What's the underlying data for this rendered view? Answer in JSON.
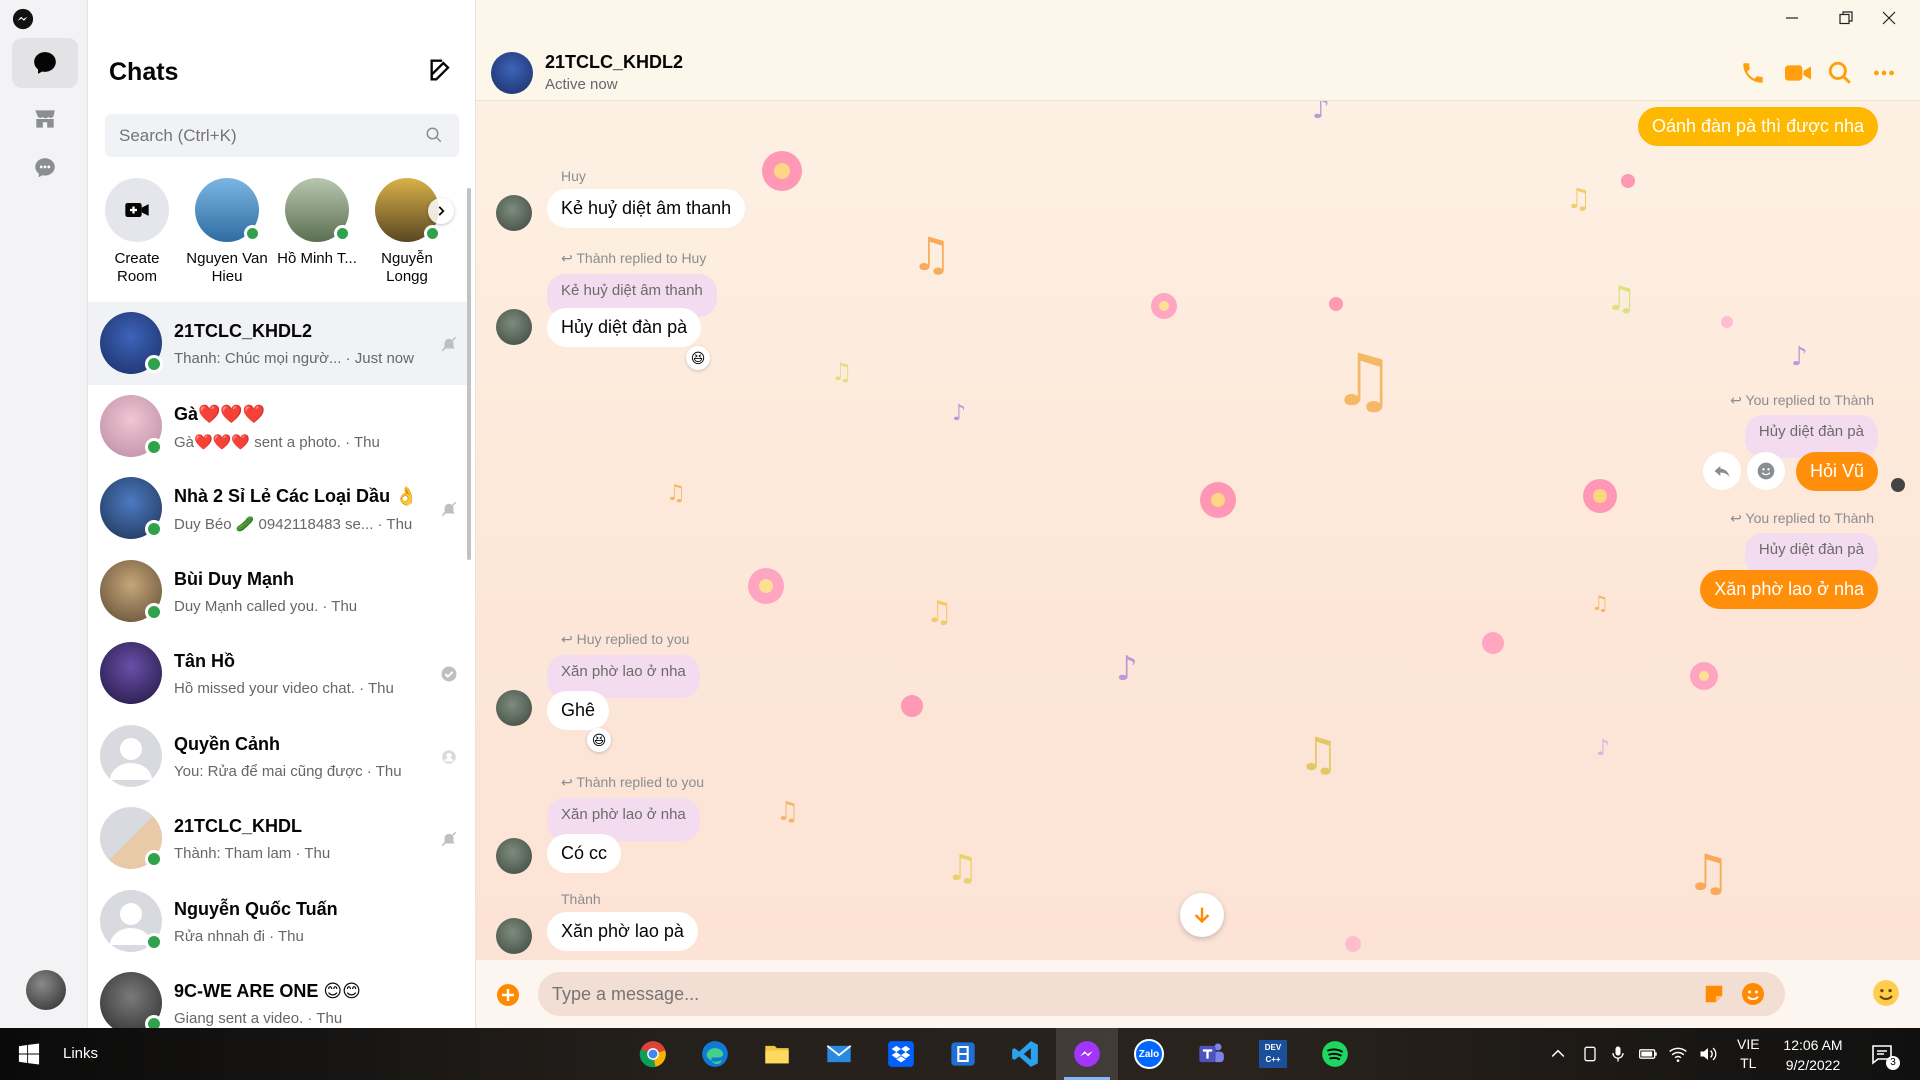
{
  "sidebar": {
    "title": "Chats",
    "search_placeholder": "Search (Ctrl+K)",
    "stories": [
      {
        "label": "Create Room"
      },
      {
        "label": "Nguyen Van Hieu",
        "online": true
      },
      {
        "label": "Hồ Minh T...",
        "online": true
      },
      {
        "label": "Nguyễn Longg",
        "online": true
      }
    ],
    "chats": [
      {
        "name": "21TCLC_KHDL2",
        "preview": "Thanh: Chúc mọi ngườ... · Just now",
        "online": true,
        "status_icon": "muted-bell-icon",
        "active": true
      },
      {
        "name": "Gà❤️❤️❤️",
        "preview": "Gà❤️❤️❤️ sent a photo. · Thu",
        "online": true,
        "status_icon": ""
      },
      {
        "name": "Nhà 2 Sỉ Lẻ Các Loại Dầu 👌",
        "preview": "Duy Béo 🥒 0942118483 se... · Thu",
        "online": true,
        "status_icon": "muted-bell-icon"
      },
      {
        "name": "Bùi Duy Mạnh",
        "preview": "Duy Mạnh called you. · Thu",
        "online": true,
        "status_icon": ""
      },
      {
        "name": "Tân Hồ",
        "preview": "Hồ missed your video chat. · Thu",
        "online": false,
        "status_icon": "delivered-check-icon"
      },
      {
        "name": "Quyền Cảnh",
        "preview": "You: Rửa để mai cũng được · Thu",
        "online": false,
        "status_icon": "seen-avatar-icon"
      },
      {
        "name": "21TCLC_KHDL",
        "preview": "Thành: Tham lam · Thu",
        "online": true,
        "status_icon": "muted-bell-icon"
      },
      {
        "name": "Nguyễn Quốc Tuấn",
        "preview": "Rửa nhnah đi · Thu",
        "online": true,
        "status_icon": ""
      },
      {
        "name": "9C-WE ARE ONE 😊😊",
        "preview": "Giang sent a video. · Thu",
        "online": true,
        "status_icon": ""
      }
    ]
  },
  "conversation": {
    "title": "21TCLC_KHDL2",
    "status": "Active now",
    "theme_colors": {
      "accent": "#ff8a00",
      "accent_yellow": "#ffb800",
      "quoted_bg": "#f3dcef"
    },
    "messages": {
      "m0": {
        "text": "Oánh đàn pà thì được nha"
      },
      "m1": {
        "sender": "Huy",
        "text": "Kẻ huỷ diệt âm thanh"
      },
      "m2": {
        "reply_note": "Thành replied to Huy",
        "quoted": "Kẻ huỷ diệt âm thanh",
        "text": "Hủy diệt đàn pà",
        "reaction": "😆"
      },
      "m3": {
        "reply_note": "You replied to Thành",
        "quoted": "Hủy diệt đàn pà",
        "text": "Hỏi Vũ"
      },
      "m4": {
        "reply_note": "You replied to Thành",
        "quoted": "Hủy diệt đàn pà",
        "text": "Xăn phờ lao ở nha"
      },
      "m5": {
        "reply_note": "Huy replied to you",
        "quoted": "Xăn phờ lao ở nha",
        "text": "Ghê",
        "reaction": "😆"
      },
      "m6": {
        "reply_note": "Thành replied to you",
        "quoted": "Xăn phờ lao ở nha",
        "text": "Có cc"
      },
      "m7": {
        "sender": "Thành",
        "text": "Xăn phờ lao pà"
      }
    },
    "composer_placeholder": "Type a message..."
  },
  "taskbar": {
    "links_label": "Links",
    "apps": [
      "chrome-icon",
      "edge-icon",
      "file-explorer-icon",
      "mail-icon",
      "dropbox-icon",
      "app-icon",
      "vscode-icon",
      "messenger-icon",
      "zalo-icon",
      "teams-icon",
      "devc-icon",
      "spotify-icon"
    ],
    "zalo_label": "Zalo",
    "devc_label": "DEV C++",
    "lang_top": "VIE",
    "lang_bottom": "TL",
    "time": "12:06 AM",
    "date": "9/2/2022",
    "notification_count": "3"
  }
}
